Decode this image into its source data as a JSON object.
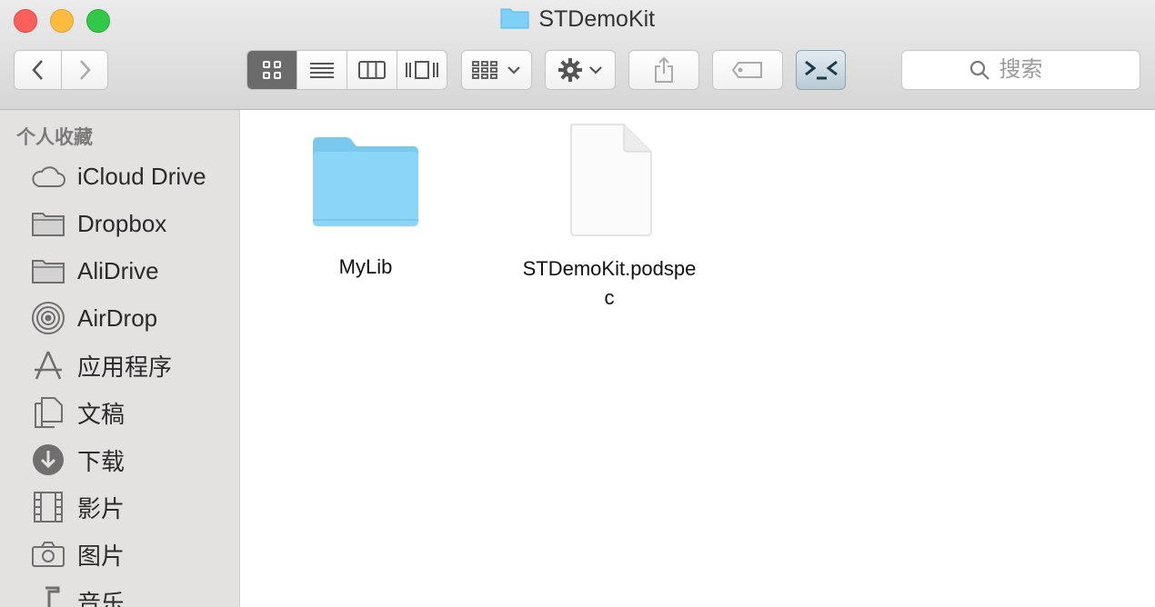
{
  "window": {
    "title": "STDemoKit"
  },
  "toolbar": {
    "search_placeholder": "搜索"
  },
  "sidebar": {
    "heading": "个人收藏",
    "items": [
      {
        "label": "iCloud Drive",
        "icon": "cloud-icon"
      },
      {
        "label": "Dropbox",
        "icon": "folder-icon"
      },
      {
        "label": "AliDrive",
        "icon": "folder-icon"
      },
      {
        "label": "AirDrop",
        "icon": "airdrop-icon"
      },
      {
        "label": "应用程序",
        "icon": "applications-icon"
      },
      {
        "label": "文稿",
        "icon": "documents-icon"
      },
      {
        "label": "下载",
        "icon": "download-icon"
      },
      {
        "label": "影片",
        "icon": "movies-icon"
      },
      {
        "label": "图片",
        "icon": "camera-icon"
      },
      {
        "label": "音乐",
        "icon": "music-icon"
      }
    ]
  },
  "files": [
    {
      "name": "MyLib",
      "kind": "folder"
    },
    {
      "name_line1": "STDemoKit.podspe",
      "name_line2": "c",
      "kind": "document"
    }
  ],
  "colors": {
    "folder": "#7fd0f7",
    "selected_view": "#6b6b6b"
  }
}
